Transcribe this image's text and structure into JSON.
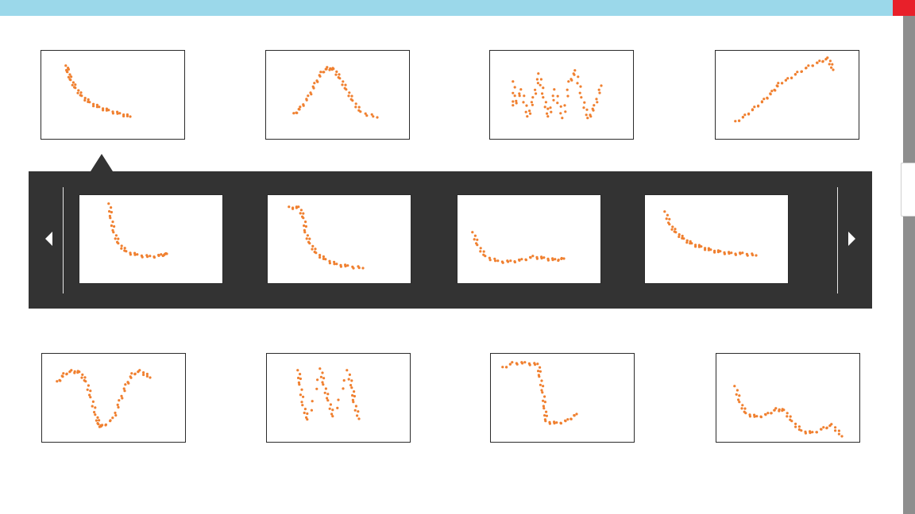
{
  "colors": {
    "accent": "#9bd8ea",
    "close": "#e8202a",
    "tray": "#333333",
    "dots": "#f08030"
  },
  "icons": {
    "prev": "chevron-left-icon",
    "next": "chevron-right-icon"
  },
  "thumbnails_top": [
    "thumb-1",
    "thumb-2",
    "thumb-3",
    "thumb-4"
  ],
  "thumbnails_tray": [
    "tray-1",
    "tray-2",
    "tray-3",
    "tray-4"
  ],
  "thumbnails_bottom": [
    "thumb-5",
    "thumb-6",
    "thumb-7",
    "thumb-8"
  ]
}
